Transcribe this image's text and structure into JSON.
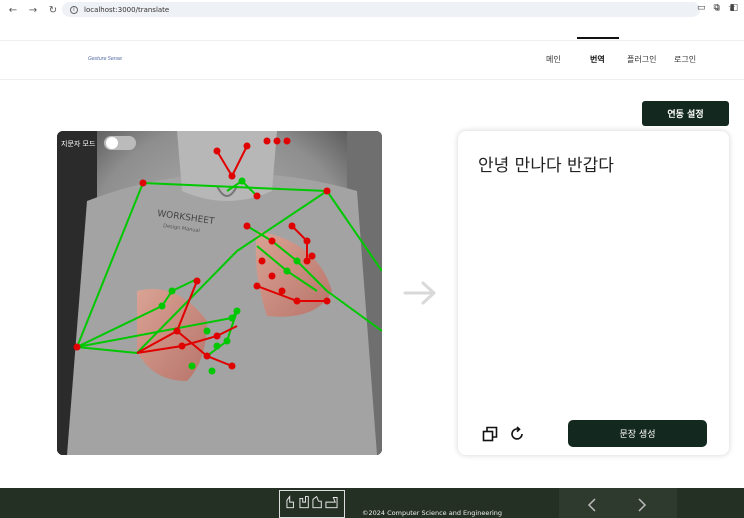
{
  "browser": {
    "url": "localhost:3000/translate"
  },
  "header": {
    "logo_text": "Gesture Sense",
    "nav": [
      {
        "label": "메인"
      },
      {
        "label": "번역"
      },
      {
        "label": "플러그인"
      },
      {
        "label": "로그인"
      }
    ],
    "active_nav": "번역"
  },
  "toolbar": {
    "sync_button": "연동 설정"
  },
  "camera": {
    "zoom_mode_label": "지문자 모드",
    "zoom_mode_on": false
  },
  "output": {
    "text": "안녕 만나다 반갑다",
    "generate_button": "문장 생성"
  },
  "footer": {
    "copyright": "©2024 Computer Science and Engineering"
  },
  "colors": {
    "primary": "#13281f",
    "landmark_point": "#e00000",
    "landmark_joint": "#00c800",
    "footer": "#243024"
  }
}
